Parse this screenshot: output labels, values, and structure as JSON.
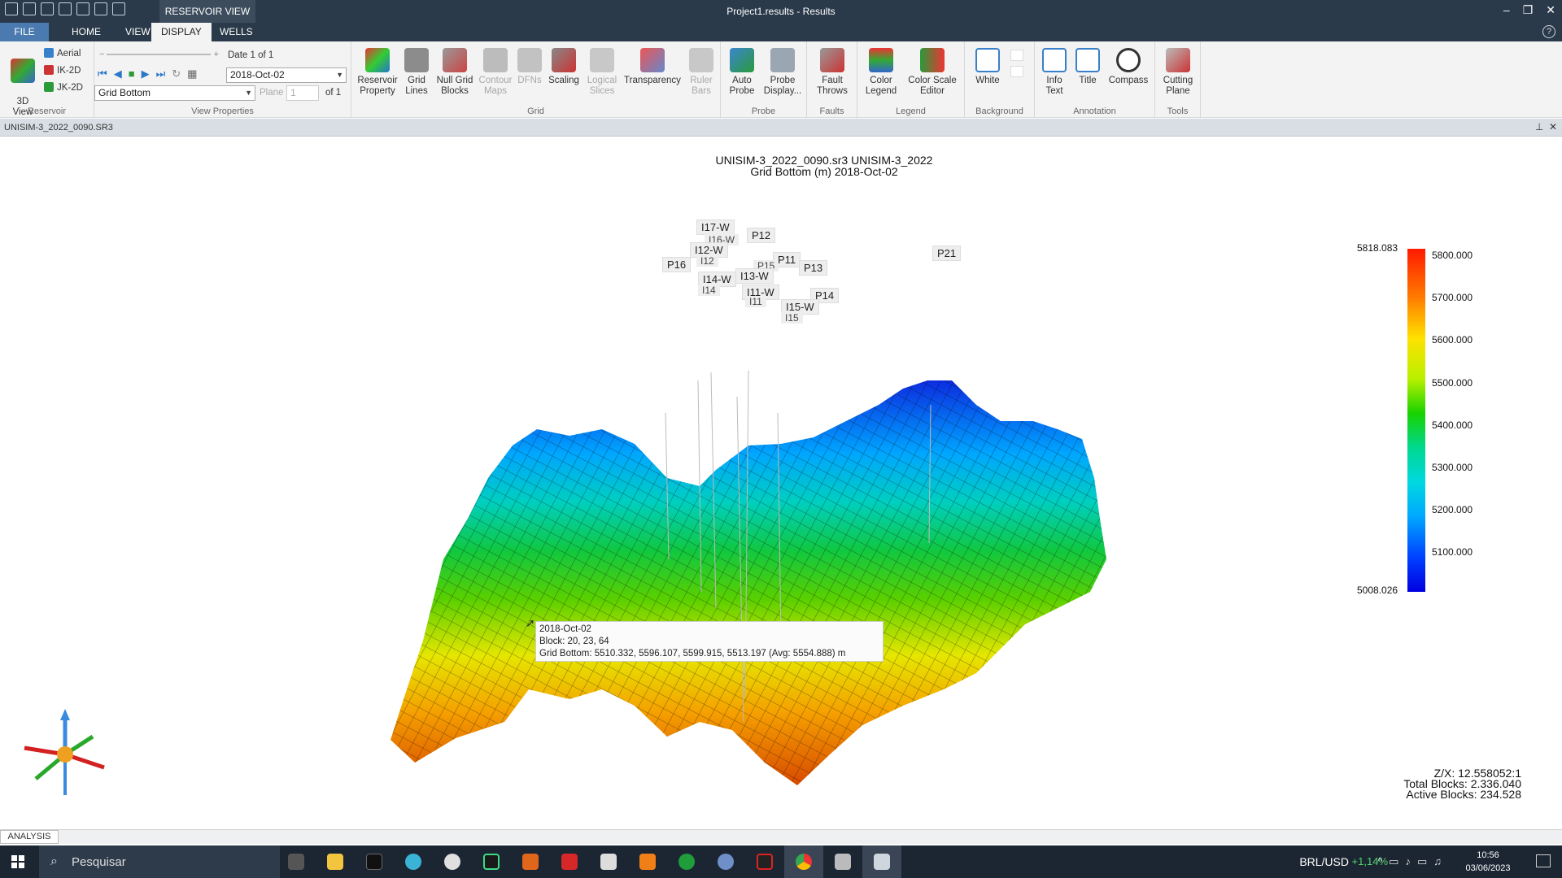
{
  "window": {
    "context_tab": "RESERVOIR VIEW",
    "title": "Project1.results - Results"
  },
  "ribbon_tabs": [
    "FILE",
    "HOME",
    "VIEW",
    "DISPLAY",
    "WELLS"
  ],
  "ribbon": {
    "reservoir": {
      "view3d": "3D\nView",
      "aerial": "Aerial",
      "ik2d": "IK-2D",
      "jk2d": "JK-2D",
      "label": "Reservoir"
    },
    "view_properties": {
      "date_label": "Date 1 of 1",
      "date_value": "2018-Oct-02",
      "property_value": "Grid Bottom",
      "plane_label": "Plane",
      "plane_value": "1",
      "plane_of": "of 1",
      "label": "View Properties"
    },
    "grid": {
      "reservoir_property": "Reservoir\nProperty",
      "grid_lines": "Grid\nLines",
      "null_grid_blocks": "Null Grid\nBlocks",
      "contour_maps": "Contour\nMaps",
      "dfns": "DFNs",
      "scaling": "Scaling",
      "logical_slices": "Logical\nSlices",
      "transparency": "Transparency",
      "ruler_bars": "Ruler\nBars",
      "label": "Grid"
    },
    "probe": {
      "auto_probe": "Auto\nProbe",
      "probe_display": "Probe\nDisplay...",
      "label": "Probe"
    },
    "faults": {
      "fault_throws": "Fault\nThrows",
      "label": "Faults"
    },
    "legend": {
      "color_legend": "Color\nLegend",
      "color_scale_editor": "Color Scale\nEditor",
      "label": "Legend"
    },
    "background": {
      "white": "White",
      "label": "Background"
    },
    "annotation": {
      "info_text": "Info\nText",
      "title": "Title",
      "compass": "Compass",
      "label": "Annotation"
    },
    "tools": {
      "cutting_plane": "Cutting\nPlane",
      "label": "Tools"
    }
  },
  "doc_tab": "UNISIM-3_2022_0090.SR3",
  "viewport": {
    "title_line1": "UNISIM-3_2022_0090.sr3 UNISIM-3_2022",
    "title_line2": "Grid Bottom (m)  2018-Oct-02",
    "wells": [
      "I17-W",
      "I16-W",
      "P12",
      "I12-W",
      "P16",
      "I12",
      "P11",
      "P15",
      "P13",
      "I13-W",
      "I14-W",
      "I14",
      "I11-W",
      "I11",
      "P14",
      "I15-W",
      "I15",
      "P21"
    ],
    "legend": {
      "max": "5818.083",
      "min": "5008.026",
      "ticks": [
        "5800.000",
        "5700.000",
        "5600.000",
        "5500.000",
        "5400.000",
        "5300.000",
        "5200.000",
        "5100.000"
      ]
    },
    "tooltip": {
      "line1": "2018-Oct-02",
      "line2": "Block: 20, 23, 64",
      "line3": "Grid Bottom: 5510.332, 5596.107, 5599.915, 5513.197 (Avg: 5554.888) m"
    },
    "stats": {
      "zx": "Z/X: 12.558052:1",
      "total": "Total Blocks: 2.336.040",
      "active": "Active Blocks: 234.528"
    }
  },
  "status_bar": {
    "analysis": "ANALYSIS"
  },
  "taskbar": {
    "search": "Pesquisar",
    "currency": "BRL/USD",
    "currency_change": "+1,14%",
    "time": "10:56",
    "date": "03/06/2023"
  },
  "colors": {
    "titlebar": "#2b3a4a",
    "ribbon": "#f3f3f3",
    "accent": "#4a7ab0",
    "taskbar": "#1c2633"
  }
}
